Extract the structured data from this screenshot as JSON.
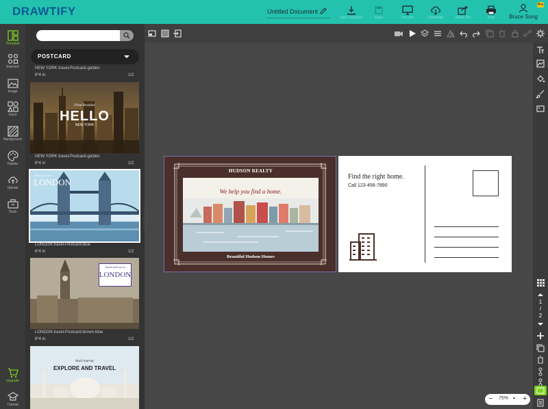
{
  "header": {
    "logo": "DRAWTIFY",
    "doc_title": "Untitled Document",
    "buttons": [
      {
        "label": "Save Template",
        "icon": "download-icon"
      },
      {
        "label": "Save",
        "icon": "save-icon"
      },
      {
        "label": "Present",
        "icon": "monitor-icon"
      },
      {
        "label": "Download",
        "icon": "cloud-download-icon"
      },
      {
        "label": "Share File",
        "icon": "share-icon"
      },
      {
        "label": "Print",
        "icon": "print-icon"
      }
    ],
    "user": "Bruce Song",
    "pro_badge": "Pro"
  },
  "rail": [
    {
      "label": "Template",
      "active": true
    },
    {
      "label": "Element"
    },
    {
      "label": "Image"
    },
    {
      "label": "Icons"
    },
    {
      "label": "Background"
    },
    {
      "label": "Palette"
    },
    {
      "label": "Upload"
    },
    {
      "label": "Tools"
    },
    {
      "label": "Upgrade"
    },
    {
      "label": "Tutorial"
    }
  ],
  "panel": {
    "category": "POSTCARD",
    "templates": [
      {
        "name": "NEW YORK travel-Postcard-golden",
        "size": "6*4 in",
        "pages": "1/2",
        "thumb_text": "HELLO",
        "thumb_sub": "NEW YORK",
        "thumb_script": "From Brooklyn"
      },
      {
        "name": "NEW YORK travel-Postcard-golden",
        "size": "6*4 in",
        "pages": "1/2",
        "thumb_text": "LONDON",
        "thumb_script": "Travel with me to"
      },
      {
        "name": "LONDON travel-Postcard-blue",
        "size": "6*4 in",
        "pages": "1/2",
        "thumb_text": "LONDON",
        "thumb_script": "Travel with me to"
      },
      {
        "name": "LONDON travel-Postcard-brown-blue",
        "size": "6*4 in",
        "pages": "1/2",
        "thumb_text": "EXPLORE AND TRAVEL",
        "thumb_script": "Arab Journey"
      }
    ]
  },
  "postcard": {
    "front_brand": "HUDSON REALTY",
    "front_tagline": "We help you find a home.",
    "front_footer": "Beautiful Hudson Homes",
    "back_title": "Find the right home.",
    "back_phone": "Call 123-456-7890"
  },
  "pager": {
    "current": "1",
    "sep": "/",
    "total": "2"
  },
  "zoom": {
    "value": "75%",
    "minus": "−",
    "plus": "+"
  }
}
